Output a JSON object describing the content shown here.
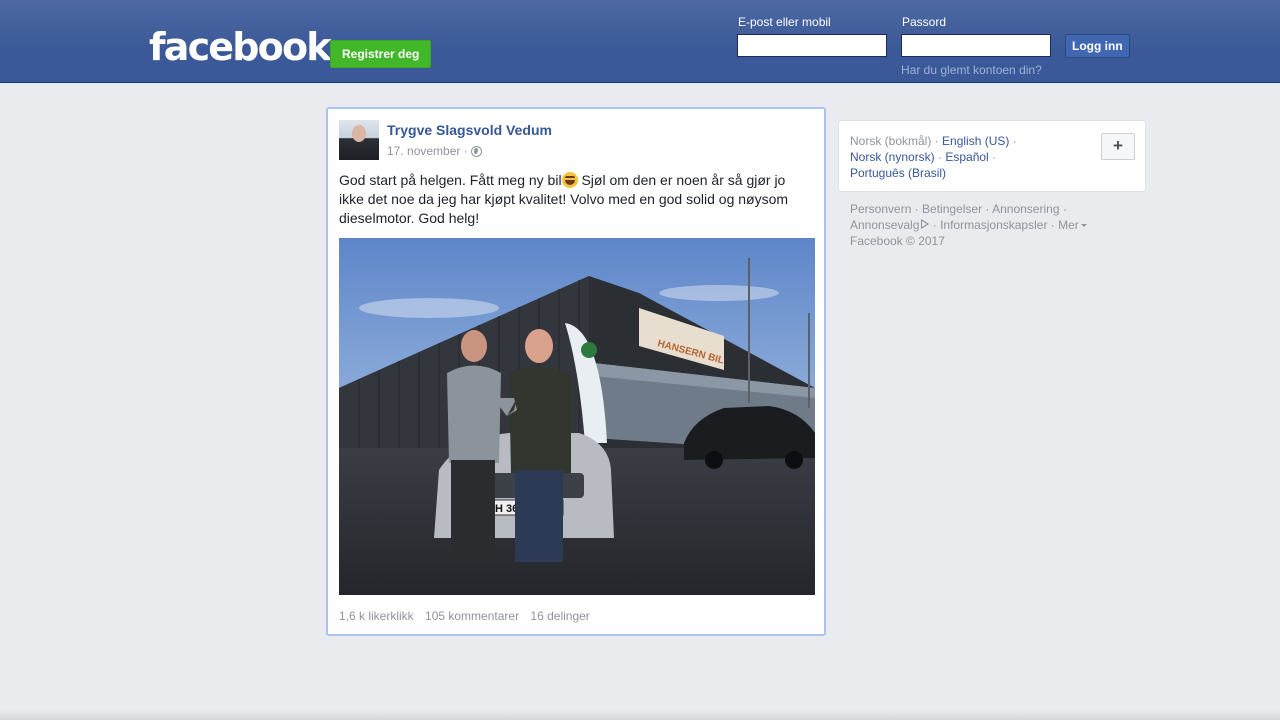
{
  "header": {
    "logo_text": "facebook",
    "register_label": "Registrer deg",
    "email_label": "E-post eller mobil",
    "email_value": "",
    "password_label": "Passord",
    "password_value": "",
    "login_label": "Logg inn",
    "forgot_label": "Har du glemt kontoen din?"
  },
  "post": {
    "author": "Trygve Slagsvold Vedum",
    "date": "17. november ·",
    "text_before_emoji": "God start på helgen. Fått meg ny bil",
    "text_after_emoji": " Sjøl om den er noen år så gjør jo ikke det noe da jeg har kjøpt kvalitet! Volvo med en god solid og nøysom dieselmotor. God helg!",
    "photo_sign": "HANSERN BIL",
    "photo_plate": "H 3646",
    "likes": "1,6 k likerklikk",
    "comments": "105 kommentarer",
    "shares": "16 delinger",
    "privacy_icon": "globe-icon",
    "emoji": "laughing-emoji"
  },
  "languages": {
    "current": "Norsk (bokmål)",
    "items": [
      "English (US)",
      "Norsk (nynorsk)",
      "Español",
      "Português (Brasil)"
    ],
    "add_label": "+"
  },
  "footer": {
    "links": [
      "Personvern",
      "Betingelser",
      "Annonsering",
      "Annonsevalg",
      "Informasjonskapsler",
      "Mer"
    ],
    "copyright": "Facebook © 2017"
  },
  "colors": {
    "topbar": "#3b5998",
    "link": "#365899",
    "register_green": "#42b72a",
    "background": "#e9ebee"
  }
}
